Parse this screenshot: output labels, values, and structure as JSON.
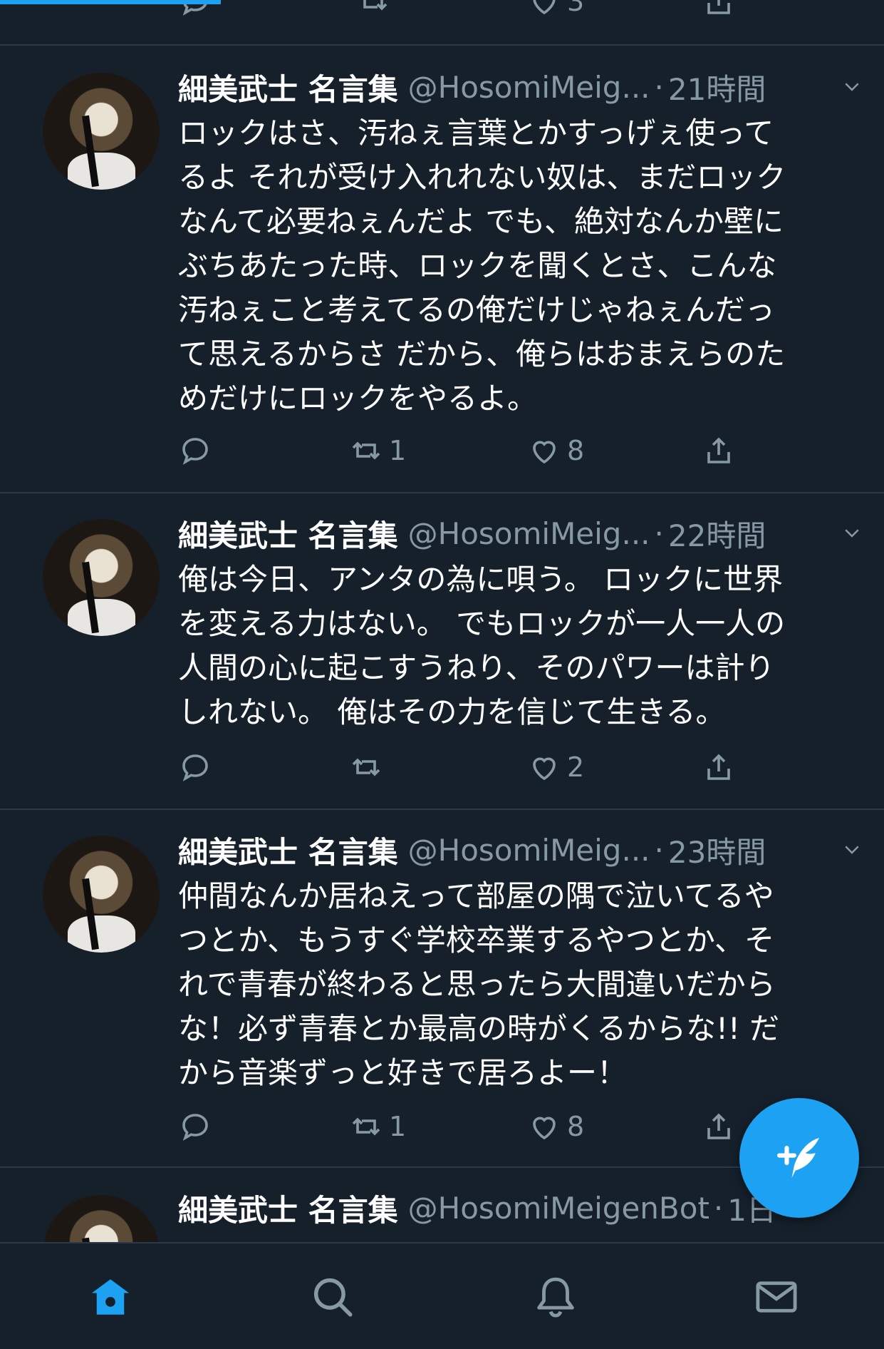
{
  "colors": {
    "background": "#15202b",
    "accent": "#1da1f2",
    "secondary_text": "#8899a6",
    "divider": "#2a3a4a"
  },
  "top_partial_actions": {
    "like_count": "3"
  },
  "tweets": [
    {
      "name": "細美武士 名言集",
      "handle": "@HosomiMeig...",
      "time": "21時間",
      "text": "ロックはさ、汚ねぇ言葉とかすっげぇ使って\nるよ それが受け入れれない奴は、まだロック\nなんて必要ねぇんだよ でも、絶対なんか壁に\nぶちあたった時、ロックを聞くとさ、こんな\n汚ねぇこと考えてるの俺だけじゃねぇんだっ\nて思えるからさ だから、俺らはおまえらのた\nめだけにロックをやるよ。",
      "retweets": "1",
      "likes": "8"
    },
    {
      "name": "細美武士 名言集",
      "handle": "@HosomiMeig...",
      "time": "22時間",
      "text": "俺は今日、アンタの為に唄う。 ロックに世界\nを変える力はない。 でもロックが一人一人の\n人間の心に起こすうねり、そのパワーは計り\nしれない。 俺はその力を信じて生きる。",
      "retweets": "",
      "likes": "2"
    },
    {
      "name": "細美武士 名言集",
      "handle": "@HosomiMeig...",
      "time": "23時間",
      "text": "仲間なんか居ねえって部屋の隅で泣いてるや\nつとか、もうすぐ学校卒業するやつとか、そ\nれで青春が終わると思ったら大間違いだから\nな！必ず青春とか最高の時がくるからな!! だ\nから音楽ずっと好きで居ろよー！",
      "retweets": "1",
      "likes": "8"
    },
    {
      "name": "細美武士 名言集",
      "handle": "@HosomiMeigenBot",
      "time": "1日"
    }
  ],
  "icons": {
    "reply": "reply-icon",
    "retweet": "retweet-icon",
    "like": "heart-icon",
    "share": "share-icon",
    "compose": "compose-tweet-icon",
    "home": "home-icon",
    "search": "search-icon",
    "notifications": "bell-icon",
    "messages": "mail-icon"
  }
}
